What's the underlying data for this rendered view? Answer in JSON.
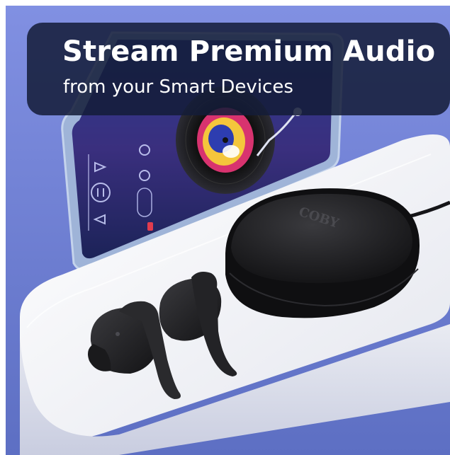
{
  "banner": {
    "title": "Stream Premium Audio",
    "subtitle": "from your Smart Devices"
  },
  "case": {
    "brand": "COBY"
  },
  "colors": {
    "background": "#7184d8",
    "caption_bg": "#141c38",
    "caption_text": "#ffffff",
    "earbuds": "#1b1b1d",
    "platform": "#f2f3f7"
  },
  "icons": [
    "music-app-screen",
    "vinyl-record",
    "earbuds",
    "charging-case"
  ]
}
